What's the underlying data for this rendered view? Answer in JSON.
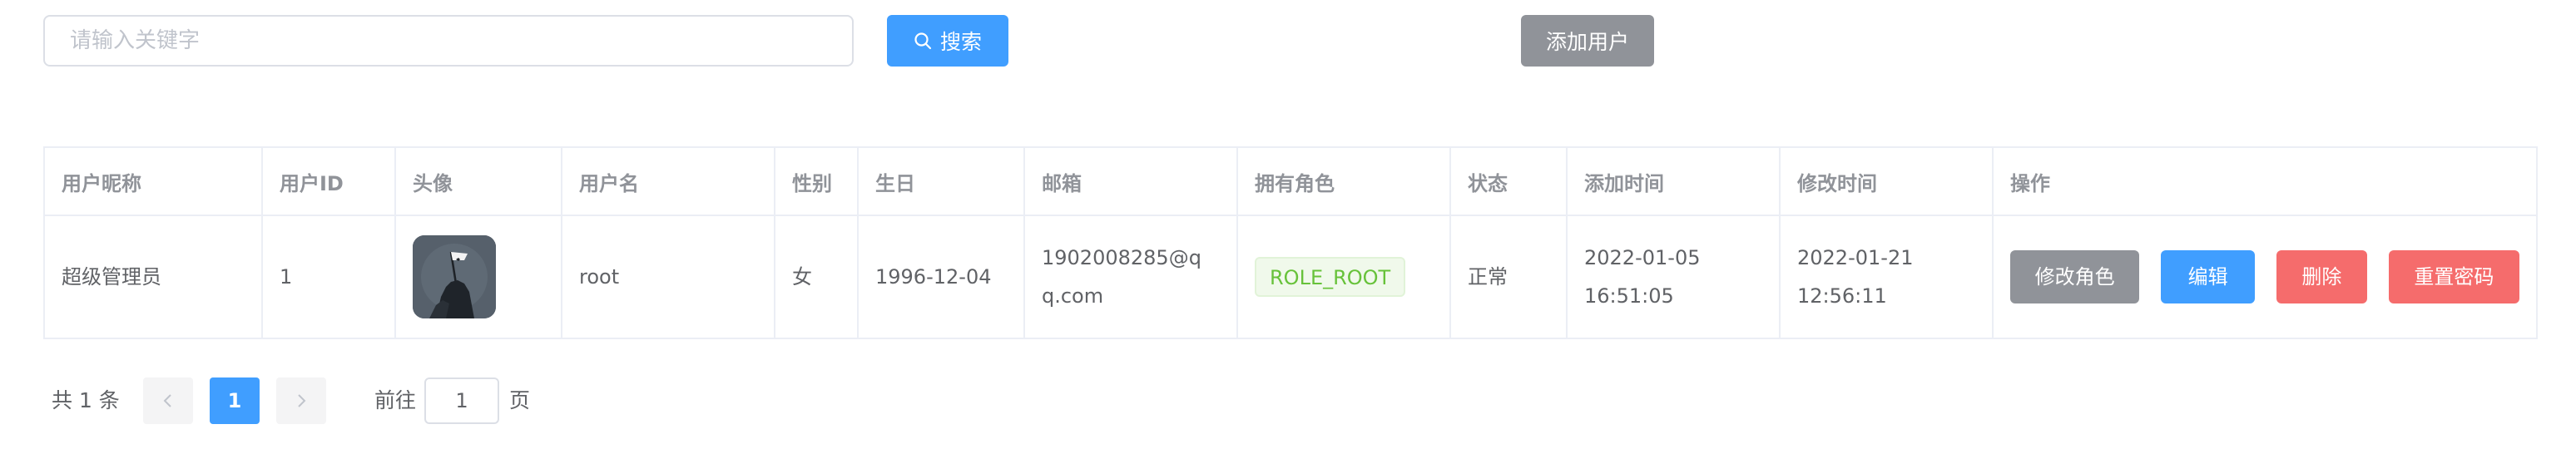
{
  "search": {
    "placeholder": "请输入关键字",
    "value": ""
  },
  "toolbar": {
    "search_label": "搜索",
    "add_user_label": "添加用户"
  },
  "table": {
    "headers": [
      "用户昵称",
      "用户ID",
      "头像",
      "用户名",
      "性别",
      "生日",
      "邮箱",
      "拥有角色",
      "状态",
      "添加时间",
      "修改时间",
      "操作"
    ],
    "rows": [
      {
        "nickname": "超级管理员",
        "user_id": "1",
        "avatar_icon": "avatar-image",
        "username": "root",
        "gender": "女",
        "birthday": "1996-12-04",
        "email": "1902008285@qq.com",
        "role": "ROLE_ROOT",
        "status": "正常",
        "created_at": "2022-01-05 16:51:05",
        "updated_at": "2022-01-21 12:56:11",
        "actions": {
          "change_role": "修改角色",
          "edit": "编辑",
          "delete": "删除",
          "reset_password": "重置密码"
        }
      }
    ]
  },
  "pagination": {
    "total_text": "共 1 条",
    "current_page": "1",
    "goto_label": "前往",
    "goto_value": "1",
    "page_suffix": "页"
  },
  "colors": {
    "primary": "#409eff",
    "info": "#909399",
    "danger": "#f56c6c",
    "success": "#67c23a"
  }
}
